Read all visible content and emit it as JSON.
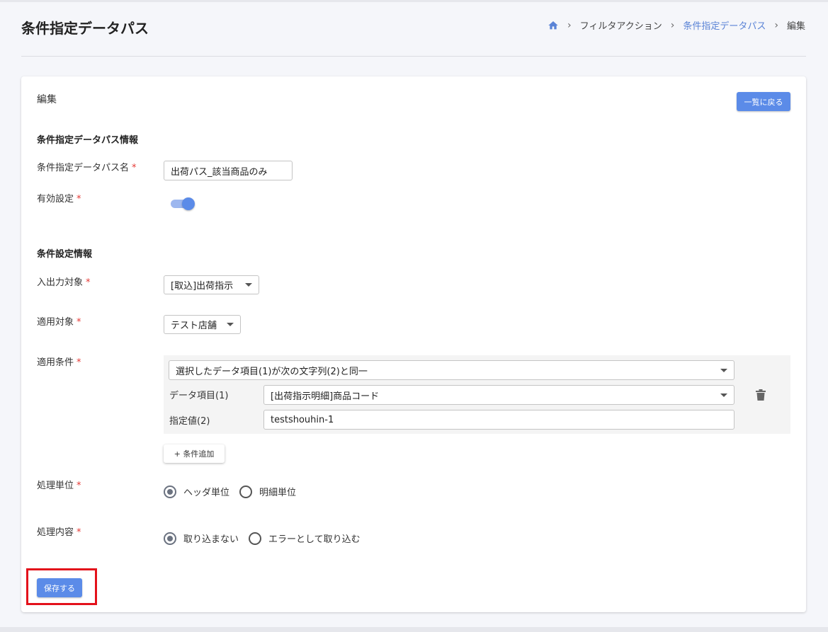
{
  "header": {
    "title": "条件指定データパス",
    "breadcrumb": [
      {
        "label": "フィルタアクション"
      },
      {
        "label": "条件指定データパス"
      },
      {
        "label": "編集"
      }
    ]
  },
  "card": {
    "label": "編集",
    "back_button": "一覧に戻る"
  },
  "section_info": {
    "title": "条件指定データパス情報",
    "name_label": "条件指定データパス名",
    "name_value": "出荷パス_該当商品のみ",
    "enabled_label": "有効設定",
    "enabled": true
  },
  "section_conditions": {
    "title": "条件設定情報",
    "io_target_label": "入出力対象",
    "io_target_value": "[取込]出荷指示",
    "apply_target_label": "適用対象",
    "apply_target_value": "テスト店舗",
    "apply_condition_label": "適用条件",
    "condition_rule": "選択したデータ項目(1)が次の文字列(2)と同一",
    "data_item_label": "データ項目(1)",
    "data_item_value": "[出荷指示明細]商品コード",
    "specified_value_label": "指定値(2)",
    "specified_value": "testshouhin-1",
    "add_condition_button": "+ 条件追加",
    "unit_label": "処理単位",
    "unit_options": [
      "ヘッダ単位",
      "明細単位"
    ],
    "unit_selected": 0,
    "content_label": "処理内容",
    "content_options": [
      "取り込まない",
      "エラーとして取り込む"
    ],
    "content_selected": 0,
    "required_mark": "*"
  },
  "save_button": "保存する",
  "colors": {
    "accent": "#5b8be8",
    "required": "#e53935",
    "highlight": "#e3111b"
  }
}
